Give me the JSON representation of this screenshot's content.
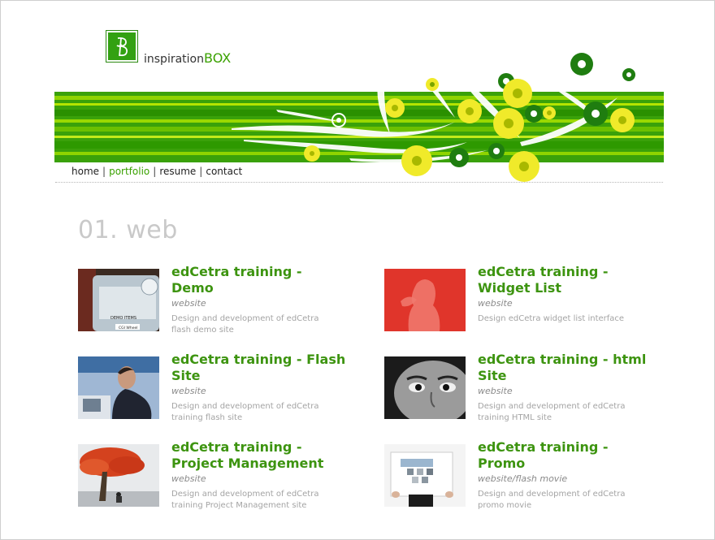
{
  "logo": {
    "prefix": "inspiration",
    "suffix": "BOX"
  },
  "nav": [
    {
      "label": "home"
    },
    {
      "label": "portfolio"
    },
    {
      "label": "resume"
    },
    {
      "label": "contact"
    }
  ],
  "section_title": "01. web",
  "projects": [
    {
      "title": "edCetra training - Demo",
      "type": "website",
      "description": "Design and development of edCetra flash demo site",
      "thumb_text": "DEMO ITEMS",
      "thumb_text2": "CGI Wheel"
    },
    {
      "title": "edCetra training - Widget List",
      "type": "website",
      "description": "Design edCetra widget list interface"
    },
    {
      "title": "edCetra training - Flash Site",
      "type": "website",
      "description": "Design and development of edCetra training flash site"
    },
    {
      "title": "edCetra training - html Site",
      "type": "website",
      "description": "Design and development of edCetra training HTML site"
    },
    {
      "title": "edCetra training - Project Management",
      "type": "website",
      "description": "Design and development of edCetra training Project Management site"
    },
    {
      "title": "edCetra training - Promo",
      "type": "website/flash movie",
      "description": "Design and development of edCetra promo movie"
    }
  ],
  "colors": {
    "brand_green": "#3aa100",
    "title_green": "#3d9410",
    "banner_light": "#8bd400",
    "banner_dark": "#2a9500",
    "flower_yellow": "#f0ea2a"
  }
}
